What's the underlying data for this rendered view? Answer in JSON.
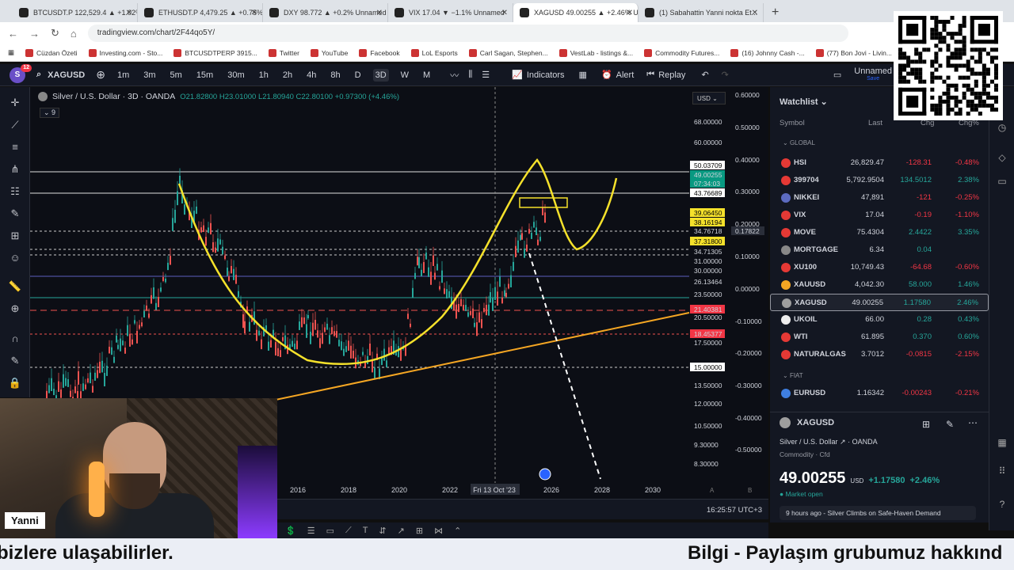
{
  "browser": {
    "tabs": [
      {
        "label": "BTCUSDT.P 122,529.4 ▲ +1.02%"
      },
      {
        "label": "ETHUSDT.P 4,479.25 ▲ +0.75%"
      },
      {
        "label": "DXY 98.772 ▲ +0.2% Unnamed"
      },
      {
        "label": "VIX 17.04 ▼ −1.1% Unnamed"
      },
      {
        "label": "XAGUSD 49.00255 ▲ +2.46% U"
      },
      {
        "label": "(1) Sabahattin Yanni nokta Et..."
      }
    ],
    "url": "tradingview.com/chart/2F44qo5Y/",
    "bookmarks": [
      "Cüzdan Özeti",
      "Investing.com - Sto...",
      "BTCUSDTPERP 3915...",
      "Twitter",
      "YouTube",
      "Facebook",
      "LoL Esports",
      "Carl Sagan, Stephen...",
      "VestLab - listings &...",
      "Commodity Futures...",
      "(16) Johnny Cash -...",
      "(77) Bon Jovi - Livin..."
    ]
  },
  "toolbar": {
    "symbol": "XAGUSD",
    "avatar": "S",
    "avatar_badge": "12",
    "timeframes": [
      "1m",
      "3m",
      "5m",
      "15m",
      "30m",
      "1h",
      "2h",
      "4h",
      "8h",
      "D",
      "3D",
      "W",
      "M"
    ],
    "selected_timeframe": "3D",
    "indicators": "Indicators",
    "alert": "Alert",
    "replay": "Replay",
    "layout_name": "Unnamed",
    "layout_status": "Save"
  },
  "chart": {
    "title": "Silver / U.S. Dollar · 3D · OANDA",
    "ohlc": "O21.82800 H23.01000 L21.80940 C22.80100 +0.97300 (+4.46%)",
    "indicator_count": "9",
    "currency": "USD",
    "price_labels": [
      "68.00000",
      "60.00000",
      "50.03709",
      "49.00255",
      "07:34:03",
      "43.76689",
      "39.06450",
      "38.16194",
      "34.76718",
      "37.31800",
      "34.71305",
      "31.00000",
      "30.00000",
      "26.13464",
      "23.50000",
      "21.40381",
      "20.50000",
      "18.45377",
      "17.50000",
      "15.00000",
      "13.50000",
      "12.00000",
      "10.50000",
      "9.30000",
      "8.30000"
    ],
    "osc_labels": [
      "0.60000",
      "0.50000",
      "0.40000",
      "0.30000",
      "0.20000",
      "0.17822",
      "0.10000",
      "0.00000",
      "-0.10000",
      "-0.20000",
      "-0.30000",
      "-0.40000",
      "-0.50000"
    ],
    "time_labels": [
      "2016",
      "2018",
      "2020",
      "2022",
      "Fri 13 Oct '23",
      "2026",
      "2028",
      "2030"
    ],
    "axis_markers": [
      "A",
      "B"
    ],
    "clock": "16:25:57 UTC+3",
    "colors": {
      "up": "#26a69a",
      "down": "#ef5350",
      "cup": "#f5e12b",
      "trend": "#f5a623"
    }
  },
  "watchlist": {
    "title": "Watchlist",
    "columns": [
      "Symbol",
      "Last",
      "Chg",
      "Chg%"
    ],
    "groups": [
      "GLOBAL",
      "FIAT"
    ],
    "rows": [
      {
        "symbol": "HSI",
        "last": "26,829.47",
        "chg": "-128.31",
        "pct": "-0.48%",
        "dir": "down",
        "color": "#e53935"
      },
      {
        "symbol": "399704",
        "last": "5,792.9504",
        "chg": "134.5012",
        "pct": "2.38%",
        "dir": "up",
        "color": "#e53935"
      },
      {
        "symbol": "NIKKEI",
        "last": "47,891",
        "chg": "-121",
        "pct": "-0.25%",
        "dir": "down",
        "color": "#5c6bc0"
      },
      {
        "symbol": "VIX",
        "last": "17.04",
        "chg": "-0.19",
        "pct": "-1.10%",
        "dir": "down",
        "color": "#e53935"
      },
      {
        "symbol": "MOVE",
        "last": "75.4304",
        "chg": "2.4422",
        "pct": "3.35%",
        "dir": "up",
        "color": "#e53935"
      },
      {
        "symbol": "MORTGAGE",
        "last": "6.34",
        "chg": "0.04",
        "pct": "",
        "dir": "up",
        "color": "#888888"
      },
      {
        "symbol": "XU100",
        "last": "10,749.43",
        "chg": "-64.68",
        "pct": "-0.60%",
        "dir": "down",
        "color": "#e53935"
      },
      {
        "symbol": "XAUUSD",
        "last": "4,042.30",
        "chg": "58.000",
        "pct": "1.46%",
        "dir": "up",
        "color": "#f5a623"
      },
      {
        "symbol": "XAGUSD",
        "last": "49.00255",
        "chg": "1.17580",
        "pct": "2.46%",
        "dir": "up",
        "color": "#9e9e9e"
      },
      {
        "symbol": "UKOIL",
        "last": "66.00",
        "chg": "0.28",
        "pct": "0.43%",
        "dir": "up",
        "color": "#eeeeee"
      },
      {
        "symbol": "WTI",
        "last": "61.895",
        "chg": "0.370",
        "pct": "0.60%",
        "dir": "up",
        "color": "#e53935"
      },
      {
        "symbol": "NATURALGAS",
        "last": "3.7012",
        "chg": "-0.0815",
        "pct": "-2.15%",
        "dir": "down",
        "color": "#e53935"
      },
      {
        "symbol": "EURUSD",
        "last": "1.16342",
        "chg": "-0.00243",
        "pct": "-0.21%",
        "dir": "down",
        "color": "#3f7fe0"
      }
    ]
  },
  "detail": {
    "symbol": "XAGUSD",
    "name": "Silver / U.S. Dollar",
    "exchange": "OANDA",
    "type": "Commodity · Cfd",
    "price": "49.00255",
    "currency": "USD",
    "change": "+1.17580",
    "change_pct": "+2.46%",
    "market_status": "Market open",
    "news_time": "9 hours ago",
    "news": "Silver Climbs on Safe-Haven Demand"
  },
  "stream": {
    "presenter": "Yanni",
    "ticker_left": "bizlere ulaşabilirler.",
    "ticker_right": "Bilgi - Paylaşım grubumuz hakkınd"
  }
}
